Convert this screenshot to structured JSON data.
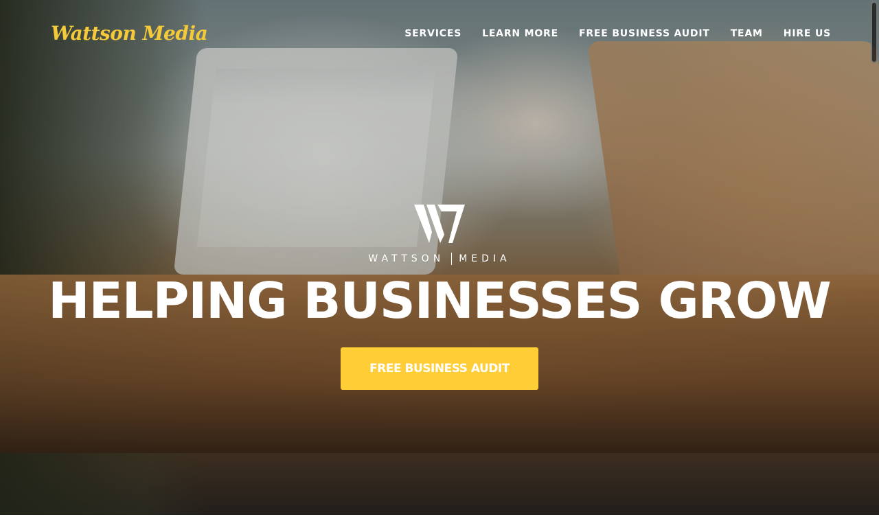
{
  "header": {
    "logo_text": "Wattson Media",
    "nav": [
      {
        "label": "SERVICES"
      },
      {
        "label": "LEARN MORE"
      },
      {
        "label": "FREE BUSINESS AUDIT"
      },
      {
        "label": "TEAM"
      },
      {
        "label": "HIRE US"
      }
    ]
  },
  "hero": {
    "brand_left": "WATTSON",
    "brand_right": "MEDIA",
    "headline": "HELPING BUSINESSES GROW",
    "cta_label": "FREE BUSINESS AUDIT"
  },
  "colors": {
    "accent": "#ffcd35",
    "logo": "#f4c93a",
    "text_light": "#ffffff"
  },
  "icons": {
    "brand_mark": "wm-logo-icon"
  }
}
